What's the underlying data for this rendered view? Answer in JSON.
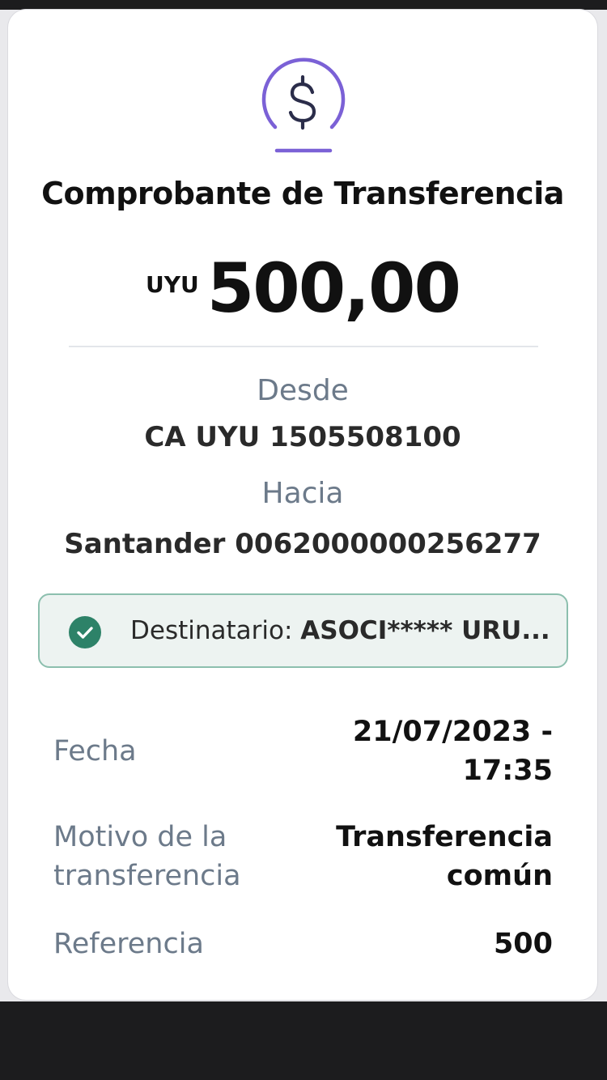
{
  "receipt": {
    "icon": "dollar-sign-icon",
    "accent_color": "#7b61d6",
    "title": "Comprobante de Transferencia",
    "currency": "UYU",
    "amount": "500,00",
    "from_label": "Desde",
    "from_value": "CA UYU 1505508100",
    "to_label": "Hacia",
    "to_value": "Santander 0062000000256277",
    "recipient": {
      "label": "Destinatario:",
      "value": "ASOCI***** URU...",
      "status_color": "#2d8268"
    },
    "details": {
      "date_label": "Fecha",
      "date_value_line1": "21/07/2023 -",
      "date_value_line2": "17:35",
      "reason_label_line1": "Motivo de la",
      "reason_label_line2": "transferencia",
      "reason_value_line1": "Transferencia",
      "reason_value_line2": "común",
      "reference_label": "Referencia",
      "reference_value": "500"
    }
  }
}
